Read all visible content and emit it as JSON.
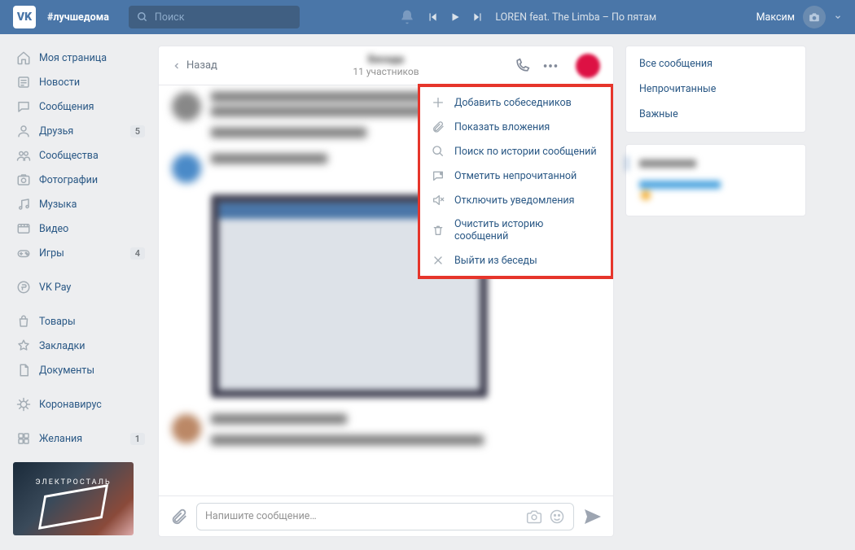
{
  "header": {
    "hashtag": "#лучшедома",
    "search_placeholder": "Поиск",
    "now_playing": "LOREN feat. The Limba – По пятам",
    "user_name": "Максим"
  },
  "sidebar": {
    "items": [
      {
        "label": "Моя страница",
        "icon": "home",
        "badge": null
      },
      {
        "label": "Новости",
        "icon": "news",
        "badge": null
      },
      {
        "label": "Сообщения",
        "icon": "messages",
        "badge": null
      },
      {
        "label": "Друзья",
        "icon": "friends",
        "badge": "5"
      },
      {
        "label": "Сообщества",
        "icon": "groups",
        "badge": null
      },
      {
        "label": "Фотографии",
        "icon": "photos",
        "badge": null
      },
      {
        "label": "Музыка",
        "icon": "music",
        "badge": null
      },
      {
        "label": "Видео",
        "icon": "video",
        "badge": null
      },
      {
        "label": "Игры",
        "icon": "games",
        "badge": "4"
      }
    ],
    "items2": [
      {
        "label": "VK Pay",
        "icon": "pay"
      }
    ],
    "items3": [
      {
        "label": "Товары",
        "icon": "market"
      },
      {
        "label": "Закладки",
        "icon": "bookmark"
      },
      {
        "label": "Документы",
        "icon": "docs"
      }
    ],
    "items4": [
      {
        "label": "Коронавирус",
        "icon": "virus"
      }
    ],
    "items5": [
      {
        "label": "Желания",
        "icon": "wish",
        "badge": "1"
      }
    ],
    "promo_text": "ЭЛЕКТРОСТАЛЬ"
  },
  "chat": {
    "back": "Назад",
    "subtitle": "11 участников",
    "dropdown": [
      {
        "label": "Добавить собеседников",
        "icon": "plus"
      },
      {
        "label": "Показать вложения",
        "icon": "clip"
      },
      {
        "label": "Поиск по истории сообщений",
        "icon": "search"
      },
      {
        "label": "Отметить непрочитанной",
        "icon": "unread"
      },
      {
        "label": "Отключить уведомления",
        "icon": "mute"
      },
      {
        "label": "Очистить историю сообщений",
        "icon": "trash"
      },
      {
        "label": "Выйти из беседы",
        "icon": "leave"
      }
    ],
    "compose_placeholder": "Напишите сообщение…"
  },
  "filters": {
    "items": [
      "Все сообщения",
      "Непрочитанные",
      "Важные"
    ]
  }
}
